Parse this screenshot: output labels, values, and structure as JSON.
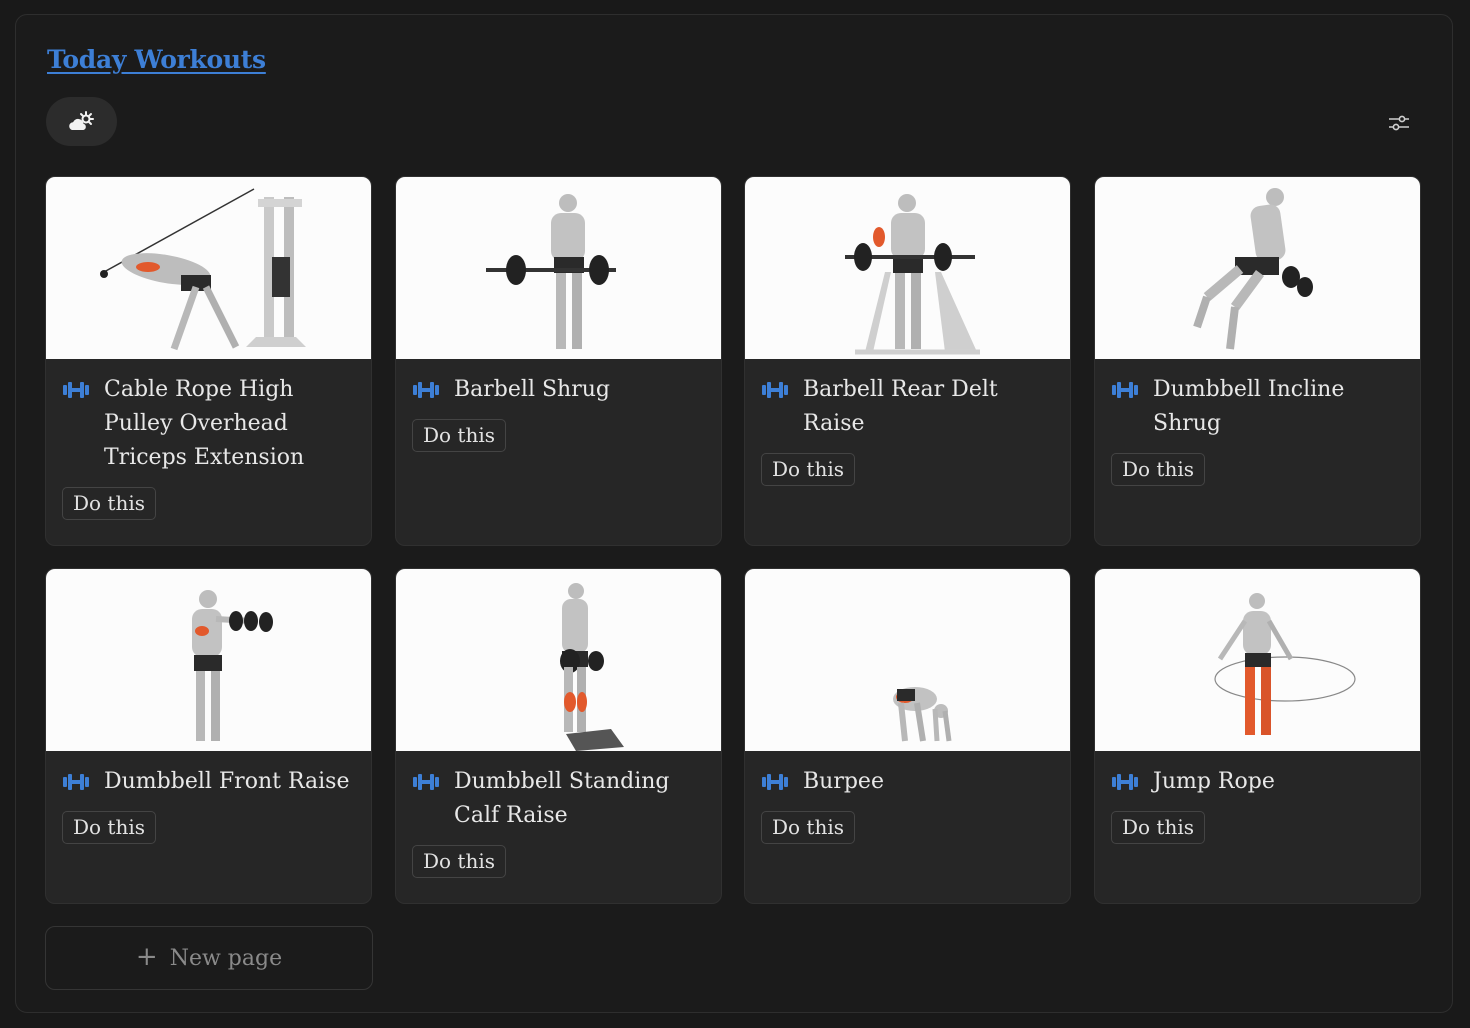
{
  "page": {
    "title": "Today Workouts"
  },
  "toolbar": {
    "view_icon": "weather-sun-cloud-icon",
    "filter_icon": "sliders-icon"
  },
  "accent": "#3d7fd6",
  "cards": [
    {
      "name": "Cable Rope High Pulley Overhead Triceps Extension",
      "button": "Do this"
    },
    {
      "name": "Barbell Shrug",
      "button": "Do this"
    },
    {
      "name": "Barbell Rear Delt Raise",
      "button": "Do this"
    },
    {
      "name": "Dumbbell Incline Shrug",
      "button": "Do this"
    },
    {
      "name": "Dumbbell Front Raise",
      "button": "Do this"
    },
    {
      "name": "Dumbbell Standing Calf Raise",
      "button": "Do this"
    },
    {
      "name": "Burpee",
      "button": "Do this"
    },
    {
      "name": "Jump Rope",
      "button": "Do this"
    }
  ],
  "new_page": {
    "label": "New page"
  }
}
